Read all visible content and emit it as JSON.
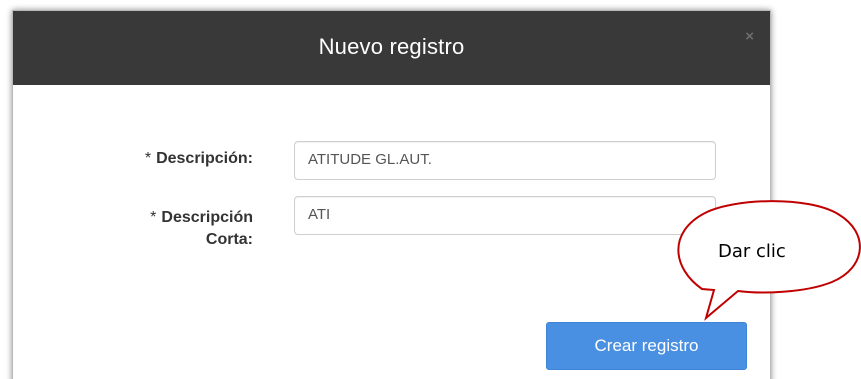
{
  "dialog": {
    "title": "Nuevo registro",
    "close_label": "×"
  },
  "form": {
    "descripcion": {
      "required_mark": "*",
      "label": "Descripción:",
      "value": "ATITUDE GL.AUT."
    },
    "descripcion_corta": {
      "required_mark": "*",
      "label_line1": "Descripción",
      "label_line2": "Corta:",
      "value": "ATI"
    }
  },
  "actions": {
    "create_label": "Crear registro"
  },
  "annotation": {
    "text": "Dar clic",
    "stroke_color": "#c00000"
  },
  "colors": {
    "header_bg": "#393939",
    "button_bg": "#4a90e2"
  }
}
